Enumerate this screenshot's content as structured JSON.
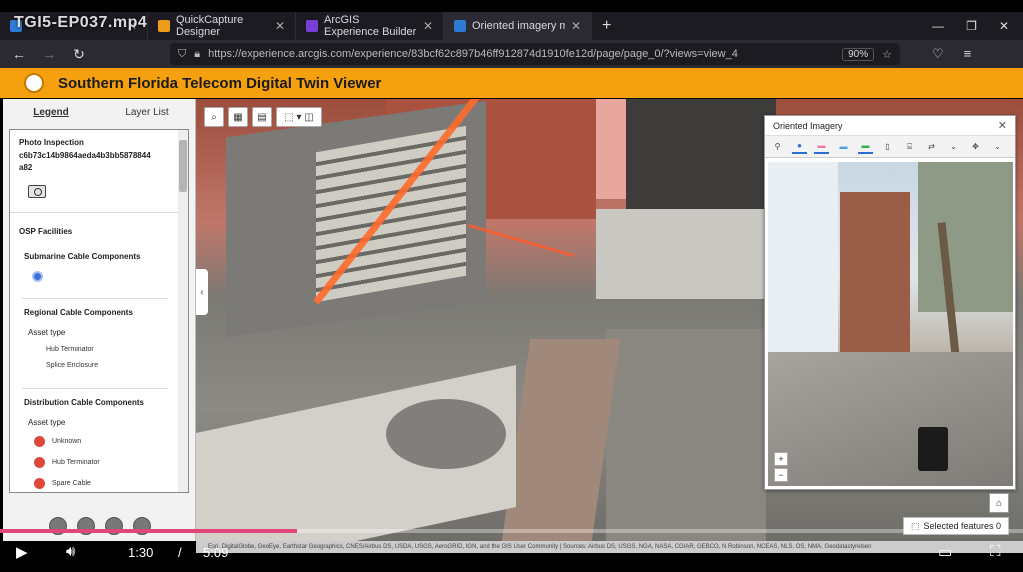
{
  "video": {
    "title": "TGI5-EP037.mp4",
    "progress": 0.29,
    "current_time": "1:30",
    "separator": "/",
    "duration": "5:09"
  },
  "browser": {
    "tabs": [
      {
        "label": "",
        "favicon_color": "#2e7bd6",
        "active": false
      },
      {
        "label": "QuickCapture Designer",
        "favicon_color": "#f09a1b",
        "active": false
      },
      {
        "label": "ArcGIS Experience Builder",
        "favicon_color": "#7a3fd6",
        "active": false
      },
      {
        "label": "Oriented imagery meets field d",
        "favicon_color": "#2e7bd6",
        "active": true
      }
    ],
    "url": "https://experience.arcgis.com/experience/83bcf62c897b46ff912874d1910fe12d/page/page_0/?views=view_4",
    "zoom": "90%"
  },
  "app": {
    "title": "Southern Florida Telecom Digital Twin Viewer",
    "accent": "#f5a00e"
  },
  "panel": {
    "tabs": [
      "Legend",
      "Layer List"
    ],
    "legend": {
      "photo_title": "Photo Inspection",
      "photo_id_1": "c6b73c14b9864aeda4b3bb5878844",
      "photo_id_2": "a82",
      "osp": "OSP Facilities",
      "submarine": "Submarine Cable Components",
      "regional": "Regional Cable Components",
      "asset_type": "Asset type",
      "hub_terminator": "Hub Terminator",
      "splice_enclosure": "Splice Enclosure",
      "distribution": "Distribution Cable Components",
      "asset_type_2": "Asset type",
      "unknown": "Unknown",
      "hub_terminator_2": "Hub Terminator",
      "spare_cable": "Spare Cable"
    }
  },
  "oriented_imagery": {
    "title": "Oriented Imagery"
  },
  "map": {
    "selected_features": "Selected features 0",
    "attribution": "Esri, DigitalGlobe, GeoEye, Earthstar Geographics, CNES/Airbus DS, USDA, USGS, AeroGRID, IGN, and the GIS User Community | Sources: Airbus DS, USGS, NGA, NASA, CGIAR, GEBCO, N Robinson, NCEAS, NLS, OS, NMA, Geodatastyrelsen"
  }
}
